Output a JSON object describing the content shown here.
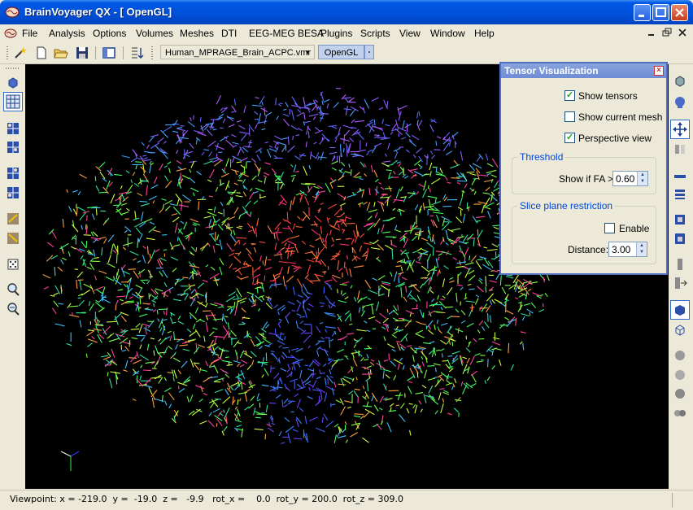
{
  "window": {
    "title": "BrainVoyager QX - [ OpenGL]"
  },
  "menu": {
    "items": [
      "File",
      "Analysis",
      "Options",
      "Volumes",
      "Meshes",
      "DTI",
      "EEG-MEG BESA",
      "Plugins",
      "Scripts",
      "View",
      "Window",
      "Help"
    ]
  },
  "toolbar": {
    "file_combo_value": "Human_MPRAGE_Brain_ACPC.vmr",
    "view_tab_label": "OpenGL",
    "icons": [
      "magic-wand-icon",
      "new-document-icon",
      "open-folder-icon",
      "save-icon",
      "window-layout-icon",
      "sort-list-icon"
    ]
  },
  "left_toolbar": {
    "icons": [
      "cube-icon",
      "grid-view-icon",
      "slice-view-1-icon",
      "slice-view-2-icon",
      "slice-view-3-icon",
      "slice-view-4-icon",
      "brain-slice-1-icon",
      "brain-slice-2-icon",
      "dice-icon",
      "zoom-in-icon",
      "zoom-out-icon"
    ]
  },
  "right_toolbar": {
    "icons": [
      "cube-rotate-icon",
      "head-icon",
      "move-arrows-icon",
      "mirror-icon",
      "flatten-icon",
      "stack-icon",
      "box-icon",
      "box-2-icon",
      "slab-icon",
      "slab-arrow-icon",
      "solid-cube-icon",
      "wire-cube-icon",
      "head-gray-1-icon",
      "head-gray-2-icon",
      "head-gray-3-icon",
      "heads-pair-icon"
    ]
  },
  "panel": {
    "title": "Tensor Visualization",
    "show_tensors_label": "Show tensors",
    "show_tensors_checked": true,
    "show_current_mesh_label": "Show current mesh",
    "show_current_mesh_checked": false,
    "perspective_view_label": "Perspective view",
    "perspective_view_checked": true,
    "threshold_group": "Threshold",
    "show_if_fa_label": "Show if FA >",
    "fa_value": "0.60",
    "slice_group": "Slice plane restriction",
    "enable_label": "Enable",
    "enable_checked": false,
    "distance_label": "Distance:",
    "distance_value": "3.00"
  },
  "status": {
    "viewpoint": "Viewpoint: x = -219.0  y =  -19.0  z =   -9.9   rot_x =    0.0  rot_y = 200.0  rot_z = 309.0"
  },
  "colors": {
    "title_bar": "#0054e3",
    "panel_title": "#7a96df",
    "viewport_bg": "#000000"
  }
}
